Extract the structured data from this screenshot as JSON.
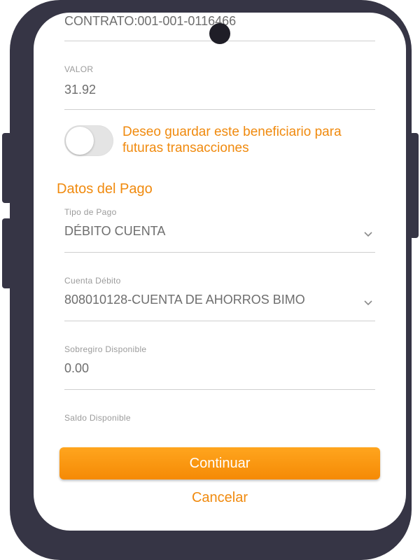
{
  "beneficiary": {
    "contract_text": "CONTRATO:001-001-0116466",
    "value_label": "VALOR",
    "value": "31.92"
  },
  "save_toggle": {
    "label": "Deseo guardar este beneficiario para futuras transacciones",
    "state": "off"
  },
  "payment": {
    "section_title": "Datos del Pago",
    "payment_type_label": "Tipo de Pago",
    "payment_type_value": "DÉBITO CUENTA",
    "debit_account_label": "Cuenta Débito",
    "debit_account_value": "808010128-CUENTA DE AHORROS BIMO",
    "overdraft_label": "Sobregiro Disponible",
    "overdraft_value": "0.00",
    "balance_label": "Saldo Disponible"
  },
  "actions": {
    "continue_label": "Continuar",
    "cancel_label": "Cancelar"
  },
  "colors": {
    "accent": "#f08a0e",
    "phone_frame": "#363545"
  },
  "icons": {
    "dropdown": "chevron-down-icon",
    "camera": "front-camera-icon"
  }
}
